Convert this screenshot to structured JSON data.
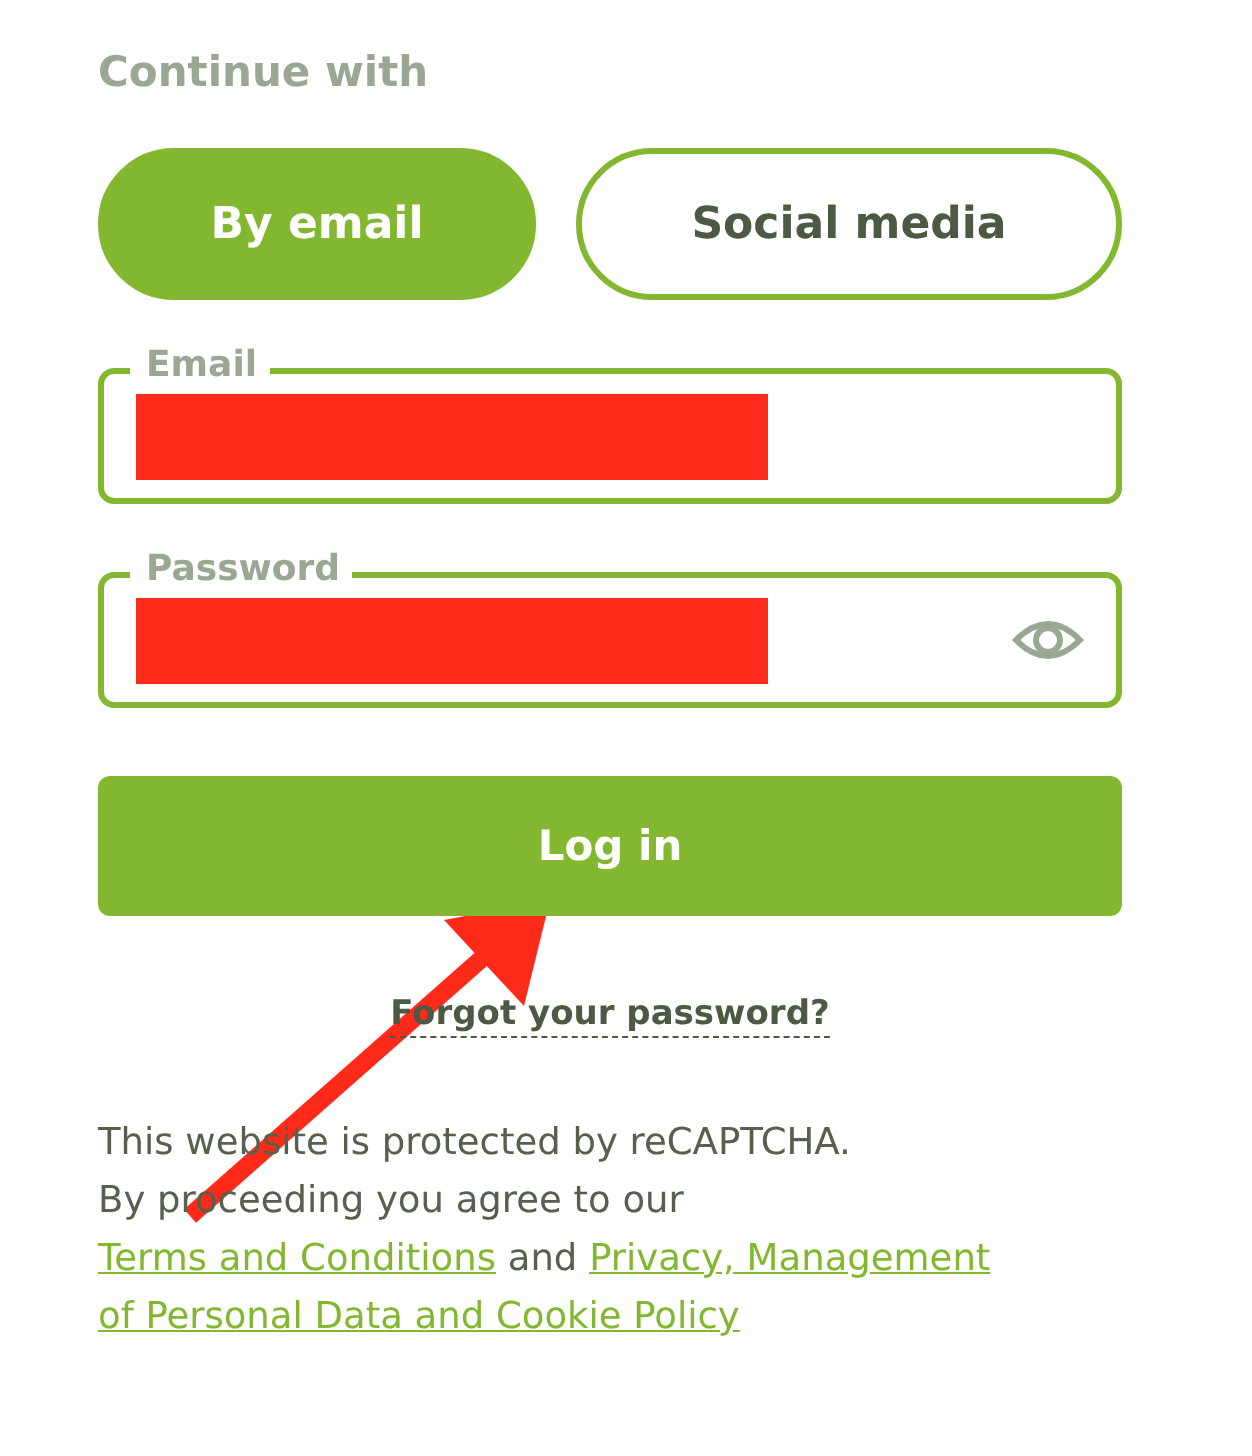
{
  "heading": "Continue with",
  "tabs": [
    {
      "label": "By email",
      "selected": true
    },
    {
      "label": "Social media",
      "selected": false
    }
  ],
  "fields": [
    {
      "label": "Email",
      "kind": "email"
    },
    {
      "label": "Password",
      "kind": "password"
    }
  ],
  "login_button": "Log in",
  "forgot_link": "Forgot your password?",
  "legal": {
    "line_1": "This website is protected by reCAPTCHA.",
    "line_2": "By proceeding you agree to our",
    "terms_link": "Terms and Conditions",
    "joiner": "and",
    "privacy_link": [
      "Privacy, Management",
      "of Personal Data and Cookie Policy"
    ]
  }
}
